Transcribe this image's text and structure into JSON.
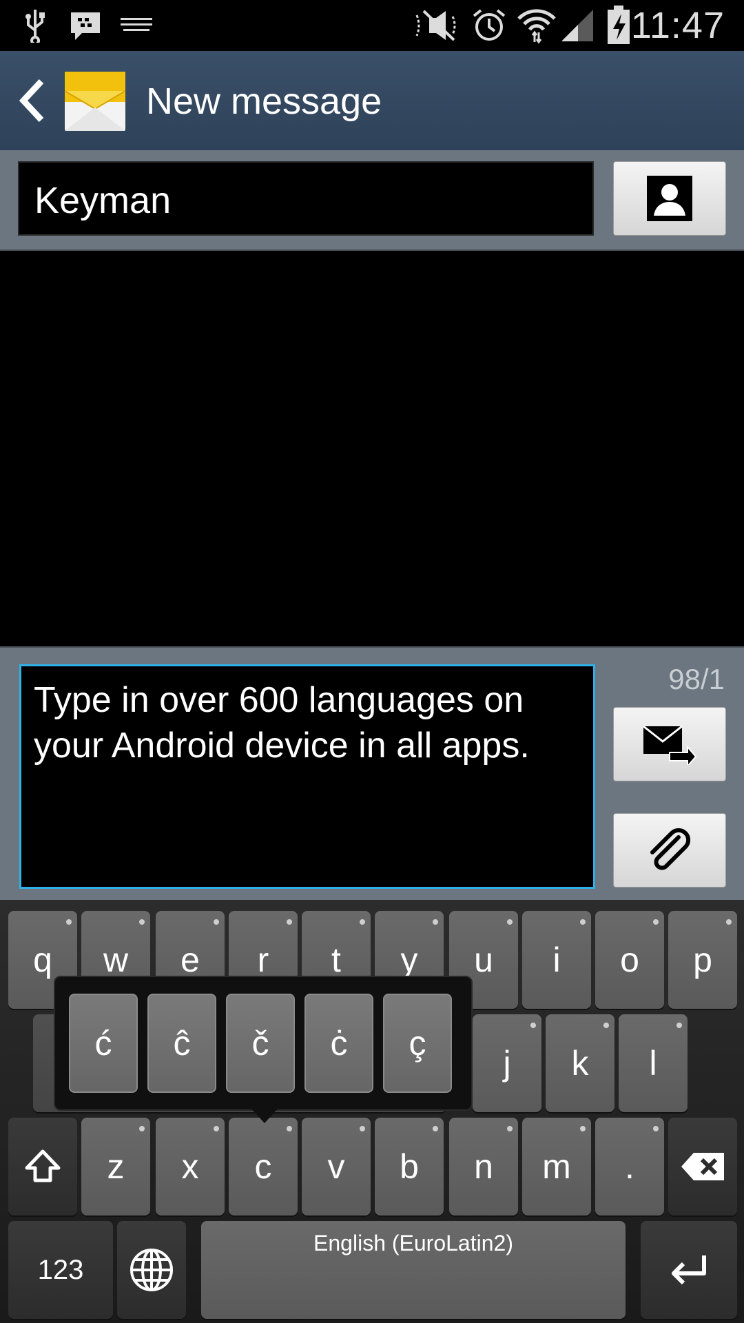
{
  "status_bar": {
    "time": "11:47",
    "icons": [
      "usb-icon",
      "bbm-icon",
      "keyboard-icon",
      "mute-icon",
      "alarm-icon",
      "wifi-icon",
      "signal-icon",
      "battery-charging-icon"
    ]
  },
  "action_bar": {
    "title": "New message",
    "back_icon": "back-chevron-icon",
    "app_icon": "envelope-icon"
  },
  "recipient": {
    "value": "Keyman",
    "contact_button_icon": "contact-icon"
  },
  "compose": {
    "message": "Type in over 600 languages on your Android device in all apps.",
    "counter": "98/1",
    "send_icon": "send-message-icon",
    "attach_icon": "paperclip-icon"
  },
  "keyboard": {
    "row1": [
      "q",
      "w",
      "e",
      "r",
      "t",
      "y",
      "u",
      "i",
      "o",
      "p"
    ],
    "row2_visible": [
      "j",
      "k",
      "l"
    ],
    "row3": [
      "z",
      "x",
      "c",
      "v",
      "b",
      "n",
      "m",
      "."
    ],
    "popup": [
      "ć",
      "ĉ",
      "č",
      "ċ",
      "ç"
    ],
    "numbers_key": "123",
    "space_label": "English (EuroLatin2)",
    "shift_icon": "shift-icon",
    "backspace_icon": "backspace-icon",
    "globe_icon": "globe-icon",
    "enter_icon": "enter-icon"
  },
  "colors": {
    "accent": "#2fb0e8",
    "action_bar": "#34495f",
    "panel": "#6b7680"
  }
}
